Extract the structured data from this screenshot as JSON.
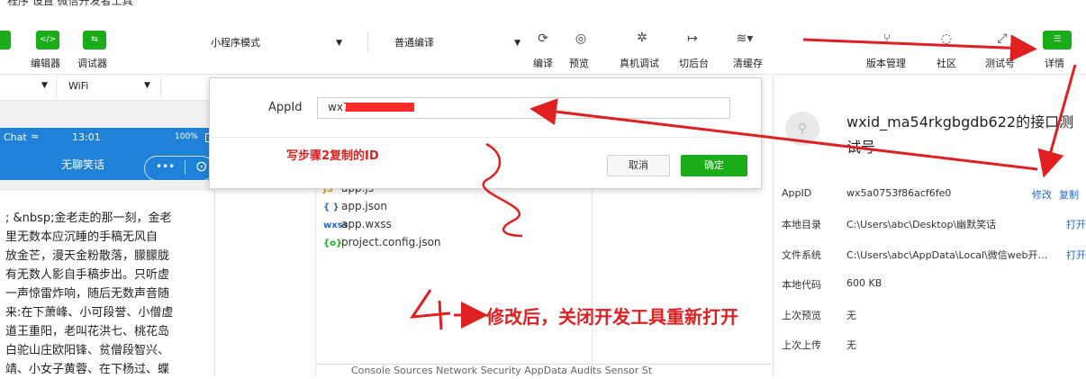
{
  "window": {
    "title": "程序 设置 微信开发者工具"
  },
  "toolbar": {
    "editor_label": "编辑器",
    "debugger_label": "调试器",
    "mode_select": "小程序模式",
    "compile_select": "普通编译",
    "compile_label": "编译",
    "preview_label": "预览",
    "device_debug_label": "真机调试",
    "background_label": "切后台",
    "clear_cache_label": "清缓存",
    "version_label": "版本管理",
    "community_label": "社区",
    "test_account_label": "测试号",
    "details_label": "详情",
    "network_select": "WiFi"
  },
  "simulator": {
    "status_carrier": "Chat",
    "status_time": "13:01",
    "status_battery": "100%",
    "nav_title": "无聊笑话",
    "capsule_more": "•••",
    "capsule_close": "⊙",
    "content_lines": [
      "; &nbsp;金老走的那一刻，金老",
      "里无数本应沉睡的手稿无风自",
      "放金芒，漫天金粉散落，朦朦胧",
      "有无数人影自手稿步出。只听虚",
      "一声惊雷炸响，随后无数声音随",
      "来:在下萧峰、小可段誉、小僧虚",
      "道王重阳，老叫花洪七、桃花岛",
      "白驼山庄欧阳锋、贫僧段智兴、",
      "靖、小女子黄蓉、在下杨过、蝶"
    ]
  },
  "files": [
    {
      "icon": "JS",
      "name": "app.js"
    },
    {
      "icon": "{ }",
      "name": "app.json"
    },
    {
      "icon": "wxss",
      "name": "app.wxss"
    },
    {
      "icon": "{o}",
      "name": "project.config.json"
    }
  ],
  "devtools_tabs": "Console   Sources   Network   Security   AppData   Audits   Sensor   St",
  "dialog": {
    "appid_label": "AppId",
    "appid_value": "wx7                    ee",
    "cancel_label": "取消",
    "ok_label": "确定"
  },
  "annotations": {
    "step2": "写步骤2复制的ID",
    "step4": "修改后，关闭开发工具重新打开"
  },
  "details": {
    "project_name": "wxid_ma54rkgbgdb622的接口测试号",
    "rows": [
      {
        "key": "AppID",
        "value": "wx5a0753f86acf6fe0",
        "links": [
          "修改",
          "复制"
        ]
      },
      {
        "key": "本地目录",
        "value": "C:\\Users\\abc\\Desktop\\幽默笑话",
        "links": [
          "打开"
        ]
      },
      {
        "key": "文件系统",
        "value": "C:\\Users\\abc\\AppData\\Local\\微信web开…",
        "links": [
          "打开"
        ]
      },
      {
        "key": "本地代码",
        "value": "600 KB",
        "links": []
      },
      {
        "key": "上次预览",
        "value": "无",
        "links": []
      },
      {
        "key": "上次上传",
        "value": "无",
        "links": []
      }
    ]
  },
  "colors": {
    "accent_green": "#1aad19",
    "nav_blue": "#1f82d8",
    "annotation_red": "#e02020",
    "link_blue": "#2d65c6"
  },
  "icons": [
    "code-icon",
    "debug-icon",
    "refresh-icon",
    "eye-icon",
    "bug-icon",
    "switch-icon",
    "layers-icon",
    "branch-icon",
    "chat-icon",
    "expand-icon",
    "menu-icon"
  ]
}
